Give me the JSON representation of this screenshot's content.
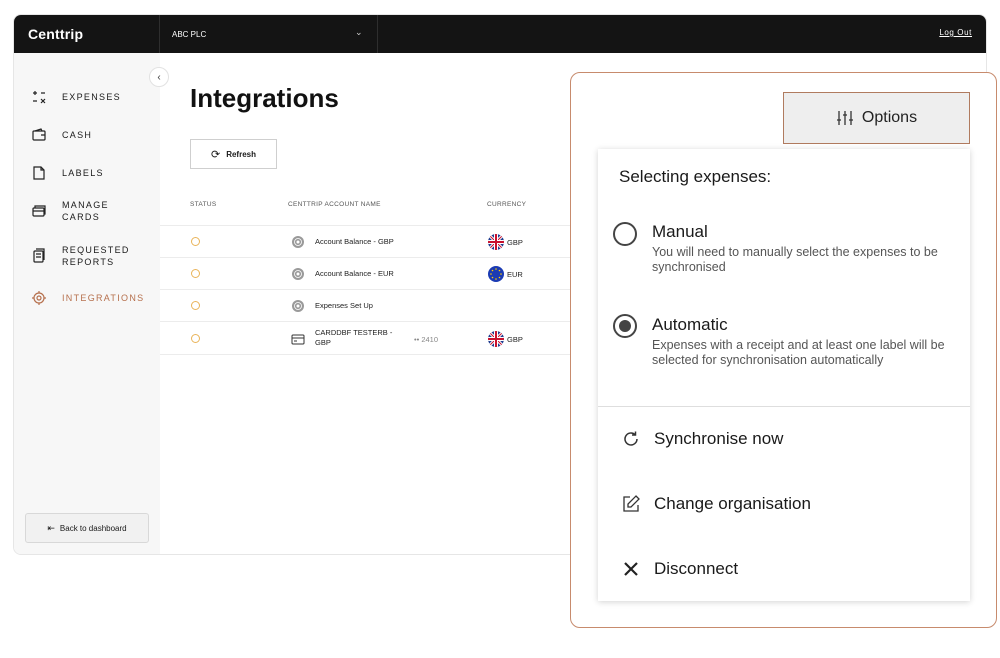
{
  "topbar": {
    "brand": "Centtrip",
    "organisation": "ABC PLC",
    "logout_label": "Log Out"
  },
  "sidebar": {
    "items": [
      {
        "label": "EXPENSES",
        "icon": "expenses-icon"
      },
      {
        "label": "CASH",
        "icon": "wallet-icon"
      },
      {
        "label": "LABELS",
        "icon": "label-icon"
      },
      {
        "label": "MANAGE\nCARDS",
        "icon": "cards-icon"
      },
      {
        "label": "REQUESTED\nREPORTS",
        "icon": "reports-icon"
      },
      {
        "label": "INTEGRATIONS",
        "icon": "integrations-icon",
        "active": true
      }
    ],
    "back_label": "Back to dashboard"
  },
  "main": {
    "title": "Integrations",
    "refresh_label": "Refresh",
    "columns": [
      "STATUS",
      "CENTTRIP ACCOUNT NAME",
      "CURRENCY"
    ],
    "rows": [
      {
        "name": "Account Balance - GBP",
        "account_number": "",
        "currency": "GBP",
        "flag": "uk-flag-icon"
      },
      {
        "name": "Account Balance - EUR",
        "account_number": "",
        "currency": "EUR",
        "flag": "eu-flag-icon"
      },
      {
        "name": "Expenses Set Up",
        "account_number": "",
        "currency": "",
        "flag": ""
      },
      {
        "name": "CARDDBF TESTERB -\nGBP",
        "account_number": "•• 2410",
        "currency": "GBP",
        "flag": "uk-flag-icon"
      }
    ]
  },
  "options_panel": {
    "button_label": "Options",
    "heading": "Selecting expenses:",
    "selection_mode": "Automatic",
    "options": [
      {
        "title": "Manual",
        "description": "You will need to manually select the expenses to be synchronised"
      },
      {
        "title": "Automatic",
        "description": "Expenses with a receipt and at least one label will be selected for synchronisation automatically"
      }
    ],
    "actions": [
      {
        "label": "Synchronise now",
        "icon": "sync-icon"
      },
      {
        "label": "Change organisation",
        "icon": "edit-icon"
      },
      {
        "label": "Disconnect",
        "icon": "close-icon"
      }
    ]
  },
  "colors": {
    "accent": "#b6704d",
    "topbar": "#141414",
    "status": "#e9b45a"
  }
}
